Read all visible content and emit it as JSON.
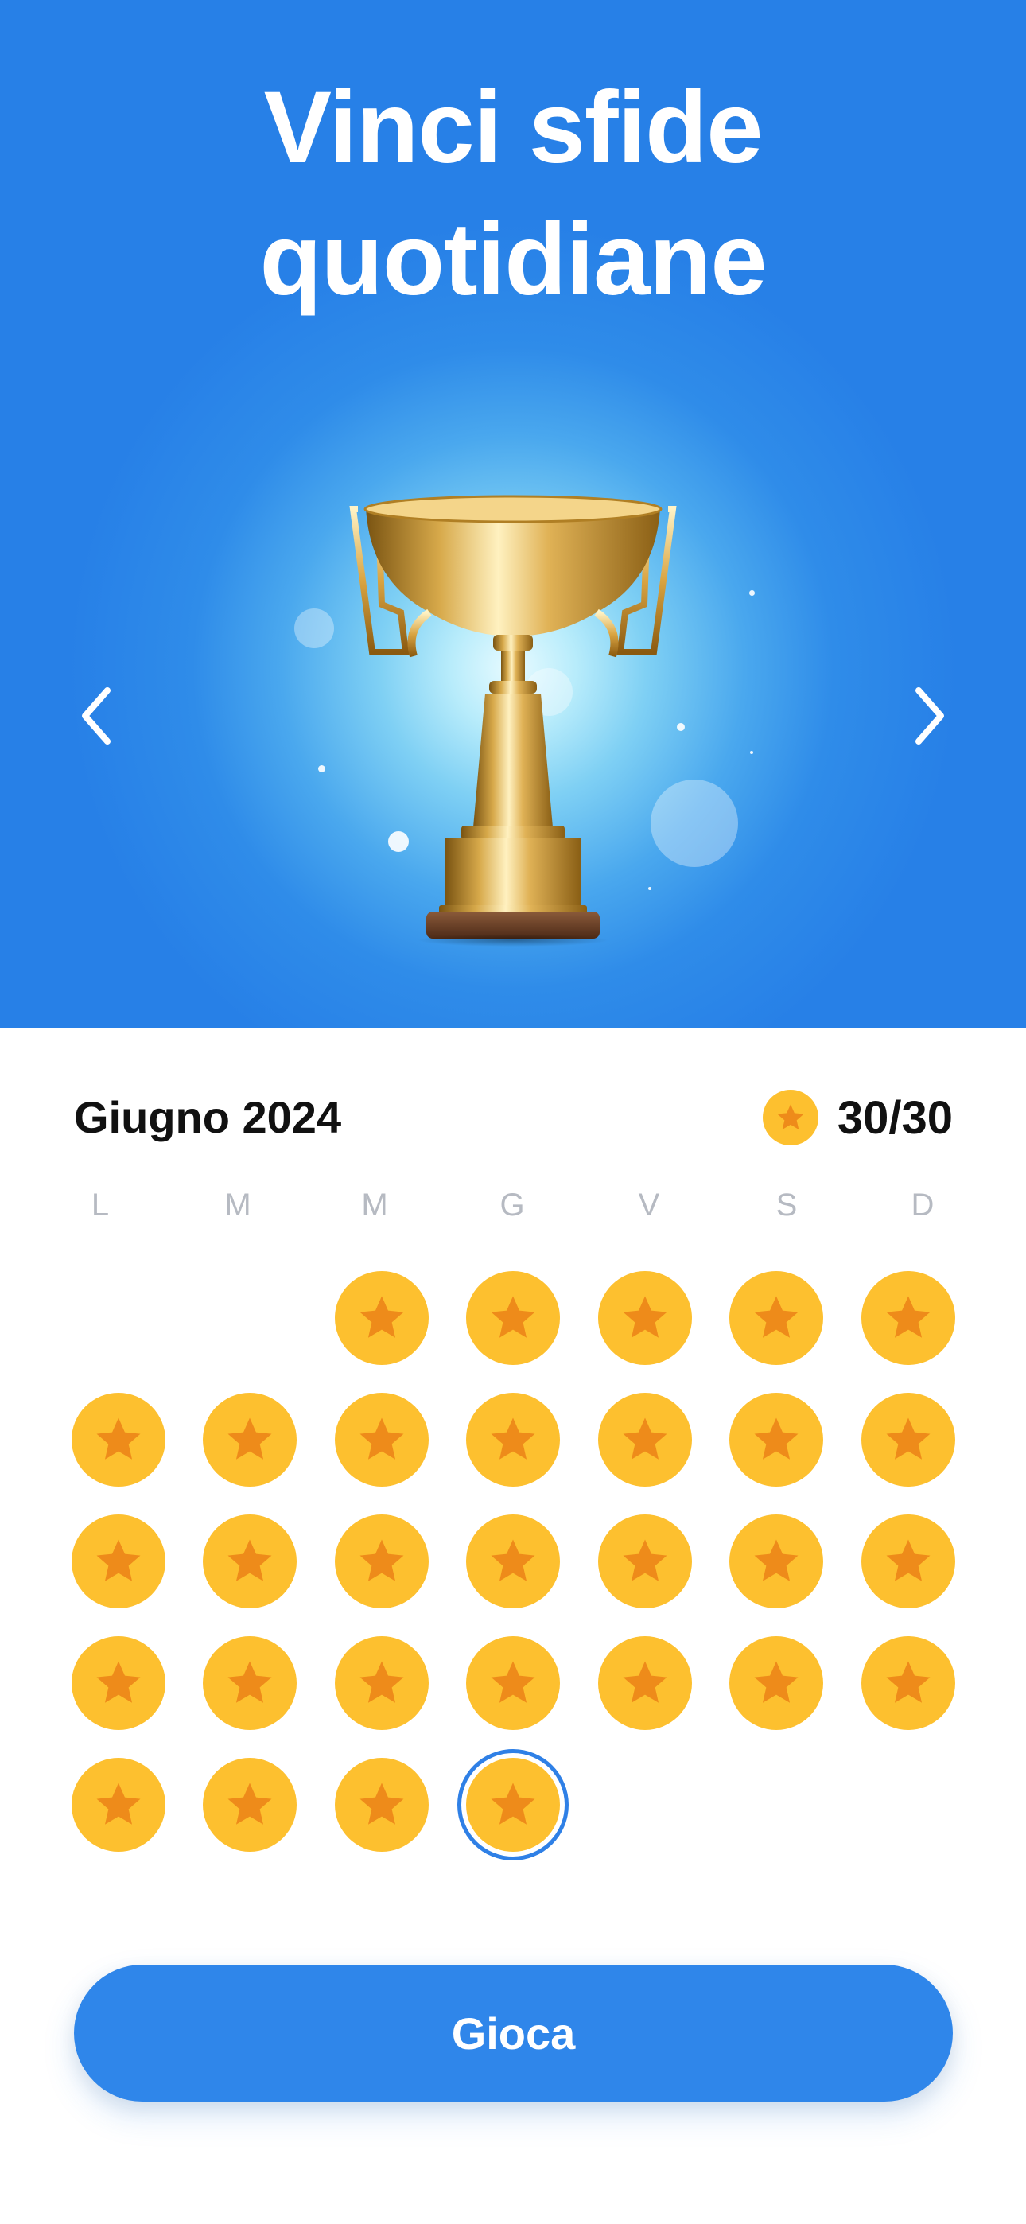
{
  "hero": {
    "title_line1": "Vinci sfide",
    "title_line2": "quotidiane",
    "image": "trophy-image",
    "prev_icon": "chevron-left-icon",
    "next_icon": "chevron-right-icon"
  },
  "calendar": {
    "month": "Giugno 2024",
    "score": "30/30",
    "score_icon": "star-coin-icon",
    "weekdays": [
      "L",
      "M",
      "M",
      "G",
      "V",
      "S",
      "D"
    ],
    "first_weekday_index": 2,
    "days_in_month": 30,
    "completed_days": 30,
    "today": 30
  },
  "cta": {
    "label": "Gioca"
  },
  "colors": {
    "primary": "#2f86ea",
    "coin": "#fdc02f",
    "star": "#ee8b1a",
    "weekday": "#b6bac2",
    "text": "#111111"
  }
}
